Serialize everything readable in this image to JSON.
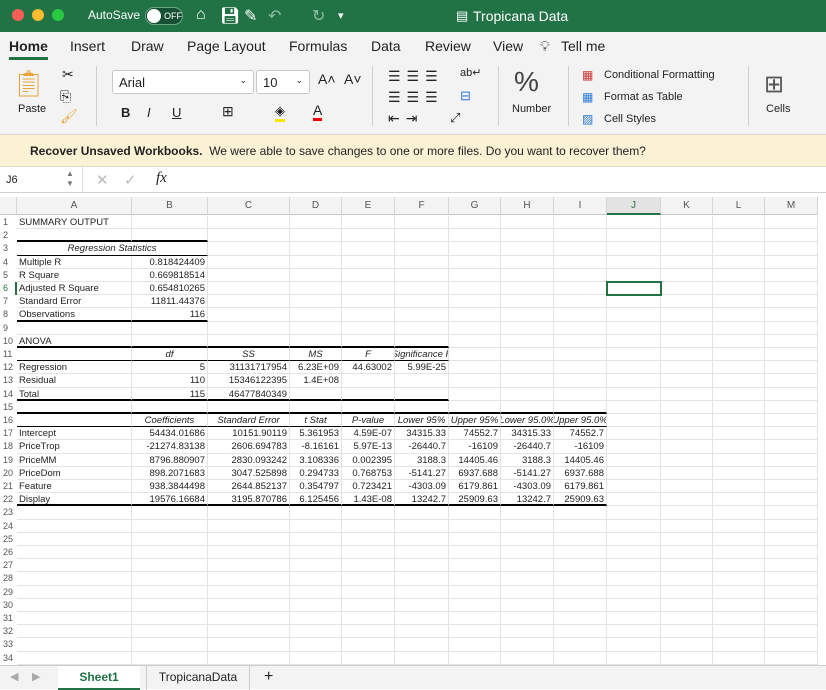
{
  "titlebar": {
    "autosave": "AutoSave",
    "toggle": "OFF",
    "title": "Tropicana Data",
    "accent": "#217346"
  },
  "tabs": [
    "Home",
    "Insert",
    "Draw",
    "Page Layout",
    "Formulas",
    "Data",
    "Review",
    "View",
    "Tell me"
  ],
  "ribbon": {
    "paste": "Paste",
    "font": "Arial",
    "size": "10",
    "number": "Number",
    "cond_format": "Conditional Formatting",
    "format_table": "Format as Table",
    "cell_styles": "Cell Styles",
    "cells": "Cells",
    "bold": "B",
    "italic": "I",
    "underline": "U"
  },
  "recover": {
    "title": "Recover Unsaved Workbooks.",
    "message": "We were able to save changes to one or more files. Do you want to recover them?"
  },
  "formula_bar": {
    "name_box": "J6",
    "fx": "fx",
    "value": ""
  },
  "columns": [
    "A",
    "B",
    "C",
    "D",
    "E",
    "F",
    "G",
    "H",
    "I",
    "J",
    "K",
    "L",
    "M"
  ],
  "selected_cell": "J6",
  "rows": [
    [
      "SUMMARY OUTPUT"
    ],
    [],
    [
      "Regression Statistics"
    ],
    [
      "Multiple R",
      "0.818424409"
    ],
    [
      "R Square",
      "0.669818514"
    ],
    [
      "Adjusted R Square",
      "0.654810265"
    ],
    [
      "Standard Error",
      "11811.44376"
    ],
    [
      "Observations",
      "116"
    ],
    [],
    [
      "ANOVA"
    ],
    [
      "",
      "df",
      "SS",
      "MS",
      "F",
      "Significance F"
    ],
    [
      "Regression",
      "5",
      "31131717954",
      "6.23E+09",
      "44.63002",
      "5.99E-25"
    ],
    [
      "Residual",
      "110",
      "15346122395",
      "1.4E+08"
    ],
    [
      "Total",
      "115",
      "46477840349"
    ],
    [],
    [
      "",
      "Coefficients",
      "Standard Error",
      "t Stat",
      "P-value",
      "Lower 95%",
      "Upper 95%",
      "Lower 95.0%",
      "Upper 95.0%"
    ],
    [
      "Intercept",
      "54434.01686",
      "10151.90119",
      "5.361953",
      "4.59E-07",
      "34315.33",
      "74552.7",
      "34315.33",
      "74552.7"
    ],
    [
      "PriceTrop",
      "-21274.83138",
      "2606.694783",
      "-8.16161",
      "5.97E-13",
      "-26440.7",
      "-16109",
      "-26440.7",
      "-16109"
    ],
    [
      "PriceMM",
      "8796.880907",
      "2830.093242",
      "3.108336",
      "0.002395",
      "3188.3",
      "14405.46",
      "3188.3",
      "14405.46"
    ],
    [
      "PriceDom",
      "898.2071683",
      "3047.525898",
      "0.294733",
      "0.768753",
      "-5141.27",
      "6937.688",
      "-5141.27",
      "6937.688"
    ],
    [
      "Feature",
      "938.3844498",
      "2644.852137",
      "0.354797",
      "0.723421",
      "-4303.09",
      "6179.861",
      "-4303.09",
      "6179.861"
    ],
    [
      "Display",
      "19576.16684",
      "3195.870786",
      "6.125456",
      "1.43E-08",
      "13242.7",
      "25909.63",
      "13242.7",
      "25909.63"
    ]
  ],
  "row_count": 34,
  "sheets": [
    "Sheet1",
    "TropicanaData"
  ],
  "active_sheet": "Sheet1"
}
